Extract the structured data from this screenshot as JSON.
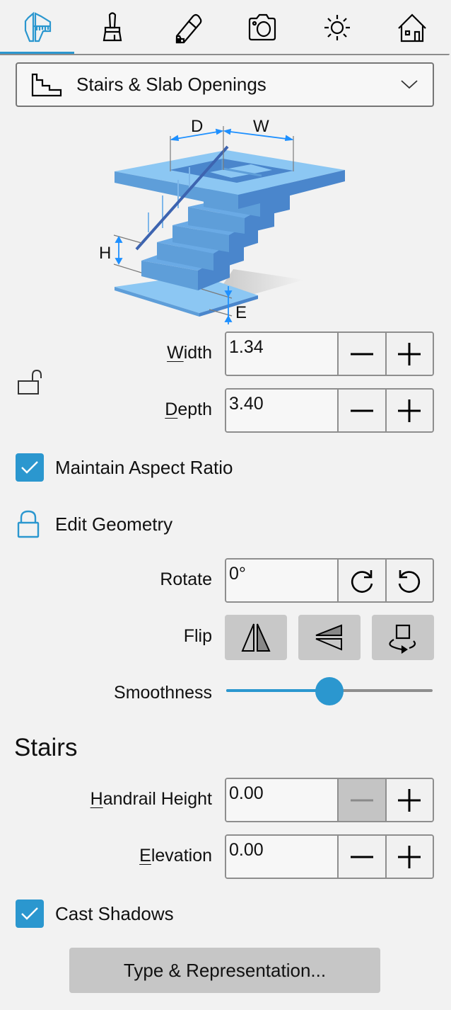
{
  "tabs": [
    {
      "name": "dimensions",
      "icon": "caliper-ruler-icon",
      "active": true
    },
    {
      "name": "appearance",
      "icon": "brush-icon",
      "active": false
    },
    {
      "name": "edit",
      "icon": "pencil-eraser-icon",
      "active": false
    },
    {
      "name": "camera",
      "icon": "camera-icon",
      "active": false
    },
    {
      "name": "lighting",
      "icon": "sun-icon",
      "active": false
    },
    {
      "name": "building",
      "icon": "house-icon",
      "active": false
    }
  ],
  "accent_color": "#2b97cf",
  "object_type": {
    "selected": "Stairs & Slab Openings",
    "icon": "stairs-icon"
  },
  "diagram": {
    "labels": {
      "d": "D",
      "w": "W",
      "h": "H",
      "e": "E"
    }
  },
  "dimensions": {
    "width": {
      "label_underline": "W",
      "label_rest": "idth",
      "value": "1.34"
    },
    "depth": {
      "label_underline": "D",
      "label_rest": "epth",
      "value": "3.40"
    },
    "lock_state": "unlocked"
  },
  "maintain_aspect_ratio": {
    "label": "Maintain Aspect Ratio",
    "checked": true
  },
  "edit_geometry": {
    "label": "Edit Geometry",
    "icon": "lock-icon"
  },
  "rotate": {
    "label": "Rotate",
    "value": "0°"
  },
  "flip": {
    "label": "Flip"
  },
  "smoothness": {
    "label": "Smoothness",
    "value": 0.5
  },
  "stairs_section": {
    "title": "Stairs",
    "handrail_height": {
      "label_underline": "H",
      "label_rest": "andrail Height",
      "value": "0.00",
      "decrement_disabled": true
    },
    "elevation": {
      "label_underline": "E",
      "label_rest": "levation",
      "value": "0.00"
    }
  },
  "cast_shadows": {
    "label": "Cast Shadows",
    "checked": true
  },
  "type_button": {
    "label": "Type & Representation..."
  }
}
